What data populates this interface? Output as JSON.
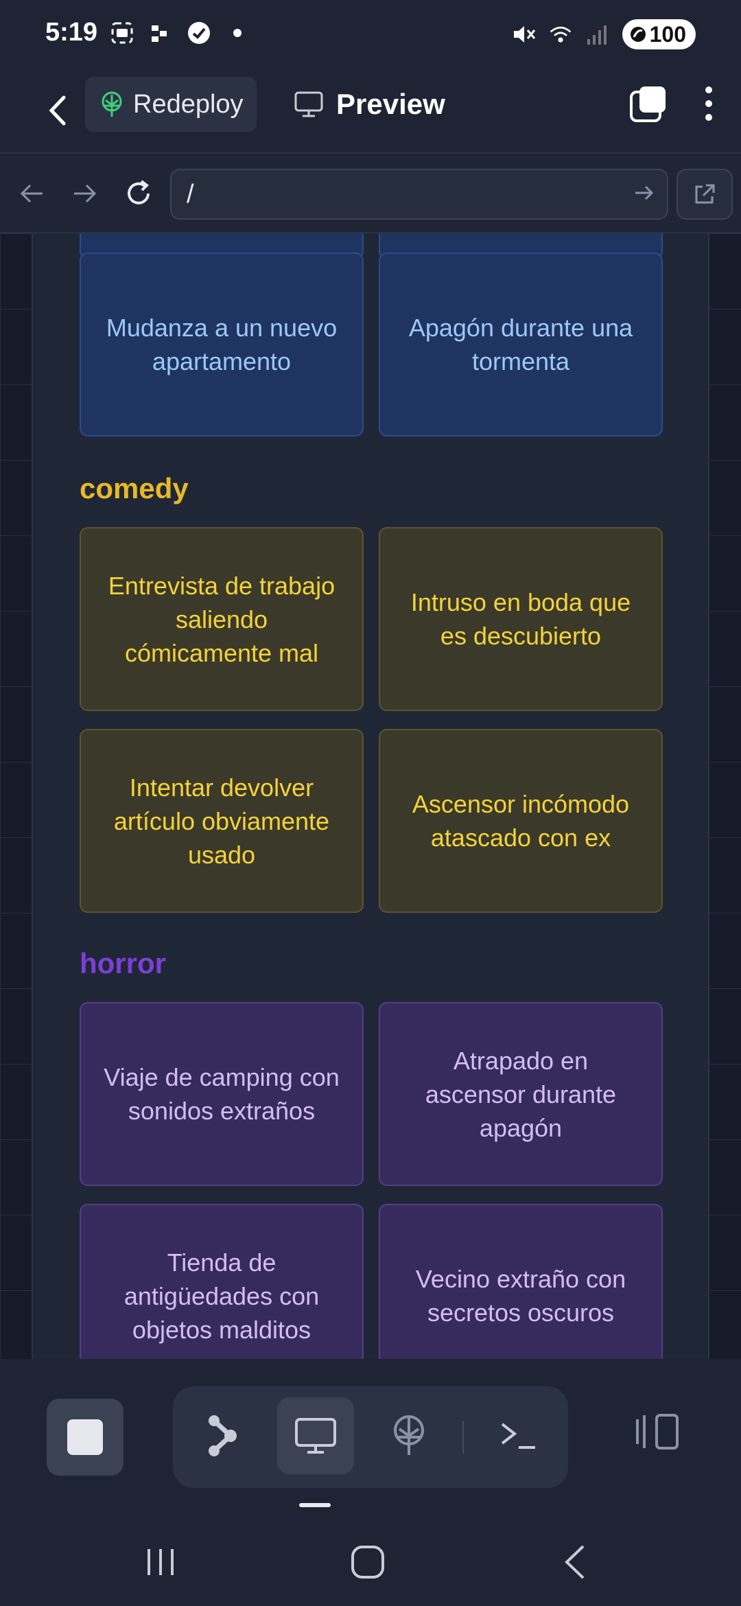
{
  "status_bar": {
    "time": "5:19",
    "left_icons": [
      "screenshot-icon",
      "app-icon",
      "check-circle-icon",
      "dot-icon"
    ],
    "right_icons": [
      "mute-icon",
      "wifi-icon",
      "signal-icon"
    ],
    "battery": "100"
  },
  "header": {
    "redeploy_label": "Redeploy",
    "preview_label": "Preview"
  },
  "url_bar": {
    "url": "/"
  },
  "sections": [
    {
      "title": "",
      "color": "#9dc8f5",
      "cards": [
        "Mudanza a un nuevo apartamento",
        "Apagón durante una tormenta"
      ]
    },
    {
      "title": "comedy",
      "color": "#e9b829",
      "cards": [
        "Entrevista de trabajo saliendo cómicamente mal",
        "Intruso en boda que es descubierto",
        "Intentar devolver artículo obviamente usado",
        "Ascensor incómodo atascado con ex"
      ]
    },
    {
      "title": "horror",
      "color": "#7b3fd6",
      "cards": [
        "Viaje de camping con sonidos extraños",
        "Atrapado en ascensor durante apagón",
        "Tienda de antigüedades con objetos malditos",
        "Vecino extraño con secretos oscuros"
      ]
    }
  ],
  "toolbar": {
    "tools": [
      "share-graph-icon",
      "monitor-icon",
      "deploy-icon",
      "terminal-icon"
    ],
    "active_tool": "monitor-icon"
  }
}
